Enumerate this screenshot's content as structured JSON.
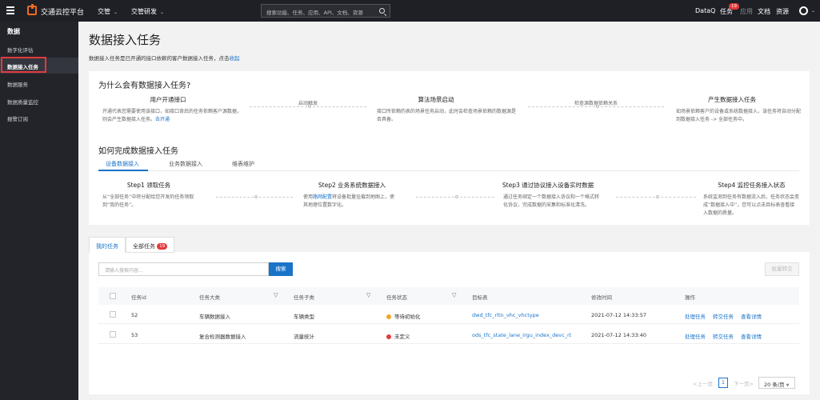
{
  "topbar": {
    "brand": "交通云控平台",
    "nav": [
      "交管",
      "交管研发"
    ],
    "search_placeholder": "搜索功能、任务、应用、API、文档、资源",
    "links": [
      "DataQ",
      "任务",
      "应用",
      "文档",
      "资源"
    ],
    "task_badge": "19"
  },
  "sidebar": {
    "title": "数据",
    "items": [
      "数字化评估",
      "数据接入任务",
      "数据服务",
      "数据质量监控",
      "报警订阅"
    ]
  },
  "header": {
    "title": "数据接入任务",
    "desc": "数据接入任务是已开通的接口依赖的客户数据接入任务，点击",
    "desc_link": "收起"
  },
  "why": {
    "title": "为什么会有数据接入任务?",
    "steps": [
      {
        "title": "用户开通接口",
        "text": "开通代表您需要使用该接口，如接口背后的任务依赖客户源数据，则会产生数据接入任务。",
        "link": "去开通"
      },
      {
        "title": "算法场景启动",
        "text": "接口所依赖的表的场景任务启动，此时会检查场景依赖的数据源是否具备。",
        "link": ""
      },
      {
        "title": "产生数据接入任务",
        "text": "如场景依赖客户的设备或系统数据接入，该任务将自动分配到数据接入任务 -> 全部任务中。",
        "link": ""
      }
    ],
    "arrows": [
      "启动触发",
      "检查源数据依赖关系"
    ]
  },
  "how": {
    "title": "如何完成数据接入任务",
    "tabs": [
      "设备数据接入",
      "业务数据接入",
      "维表维护"
    ],
    "steps": [
      {
        "title": "Step1 领取任务",
        "text": "从“全部任务”中将分配给您开发的任务领取到“我的任务”。",
        "link": ""
      },
      {
        "title": "Step2 业务系统数据接入",
        "text_a": "使用",
        "link": "路网配置",
        "text_b": "将设备批量挂载到地图上，使其地理位置数字化。"
      },
      {
        "title": "Step3 通过协议接入设备实时数据",
        "text": "通过任务绑定一个数据接入协议和一个格式转化协议，完成数据的采集和标准化清洗。",
        "link": ""
      },
      {
        "title": "Step4 监控任务接入状态",
        "text": "系统监测到任务有数据流入后，任务状态会变成“数据接入中”，您可以点击目标表查看接入数据的质量。",
        "link": ""
      }
    ]
  },
  "tasks": {
    "tabs": [
      "我的任务",
      "全部任务"
    ],
    "all_badge": "19",
    "search_placeholder": "请输入搜索内容...",
    "search_button": "搜索",
    "batch_button": "批量转交",
    "columns": [
      "任务id",
      "任务大类",
      "任务子类",
      "任务状态",
      "目标表",
      "修改时间",
      "操作"
    ],
    "rows": [
      {
        "id": "52",
        "category": "车辆数据接入",
        "sub": "车辆类型",
        "status": "等待初始化",
        "status_color": "#f5a623",
        "table": "dwd_tfc_rltn_vhc_vhctype",
        "time": "2021-07-12 14:33:57"
      },
      {
        "id": "53",
        "category": "复合检测器数据接入",
        "sub": "流量统计",
        "status": "未定义",
        "status_color": "#e4393c",
        "table": "ods_tfc_state_lane_irgu_index_devc_rt",
        "time": "2021-07-12 14:33:40"
      }
    ],
    "actions": [
      "处理任务",
      "转交任务",
      "查看详情"
    ],
    "pager": {
      "prev": "<上一页",
      "page": "1",
      "next": "下一页>",
      "size": "20 条/页"
    }
  },
  "colors": {
    "accent": "#1a73c8",
    "danger": "#e4393c",
    "topbar": "#1e2026"
  }
}
